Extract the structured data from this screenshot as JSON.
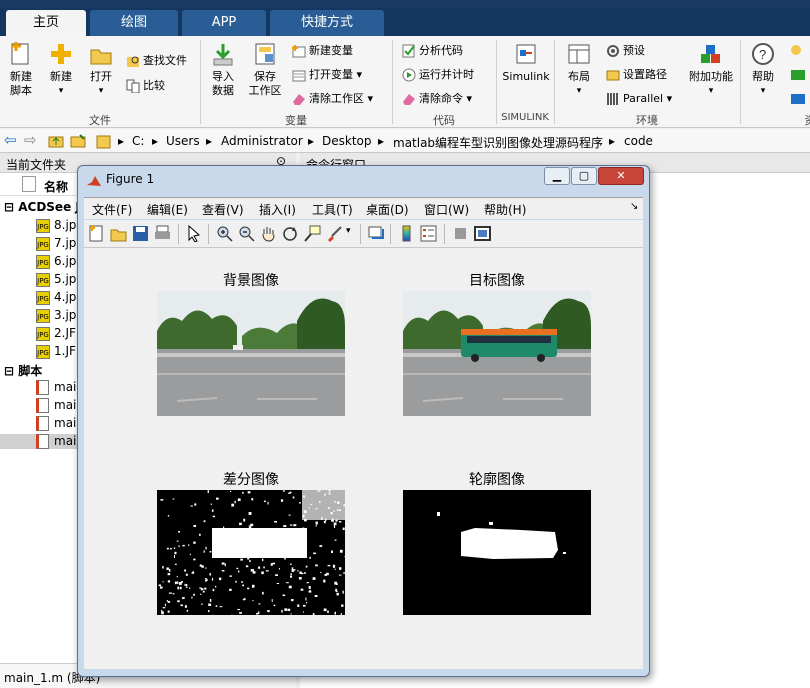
{
  "app": {
    "tabs": [
      "主页",
      "绘图",
      "APP",
      "快捷方式"
    ],
    "ribbon": {
      "file_group": {
        "label": "文件",
        "new_script": "新建\n脚本",
        "new": "新建",
        "open": "打开",
        "find_files": "查找文件",
        "compare": "比较"
      },
      "variable_group": {
        "label": "变量",
        "import": "导入\n数据",
        "save_ws": "保存\n工作区",
        "new_var": "新建变量",
        "open_var": "打开变量",
        "clear_ws": "清除工作区"
      },
      "code_group": {
        "label": "代码",
        "analyze": "分析代码",
        "run_time": "运行并计时",
        "clear_cmd": "清除命令"
      },
      "simulink_group": {
        "label": "SIMULINK",
        "simulink": "Simulink"
      },
      "env_group": {
        "label": "环境",
        "layout": "布局",
        "prefs": "预设",
        "set_path": "设置路径",
        "parallel": "Parallel",
        "addons": "附加功能"
      },
      "resources": {
        "help": "帮助",
        "cut_label": "资"
      }
    },
    "address": [
      "C:",
      "Users",
      "Administrator",
      "Desktop",
      "matlab编程车型识别图像处理源码程序",
      "code"
    ],
    "left_panel": {
      "title": "当前文件夹",
      "col_name": "名称",
      "folder1": "ACDSee J",
      "files": [
        "8.jp",
        "7.jp",
        "6.jp",
        "5.jp",
        "4.jp",
        "3.jp",
        "2.JF",
        "1.JF"
      ],
      "folder2": "脚本",
      "scripts": [
        "mai",
        "mai",
        "mai",
        "mai"
      ],
      "status": "main_1.m  (脚本)"
    },
    "cmd_panel": {
      "title": "命令行窗口"
    },
    "figure": {
      "title": "Figure 1",
      "menu": [
        "文件(F)",
        "编辑(E)",
        "查看(V)",
        "插入(I)",
        "工具(T)",
        "桌面(D)",
        "窗口(W)",
        "帮助(H)"
      ],
      "plots": [
        {
          "title": "背景图像"
        },
        {
          "title": "目标图像"
        },
        {
          "title": "差分图像"
        },
        {
          "title": "轮廓图像"
        }
      ]
    }
  },
  "colors": {
    "tabbar": "#14365f",
    "tab": "#2a5d95",
    "ribbon": "#f5f5f5"
  }
}
